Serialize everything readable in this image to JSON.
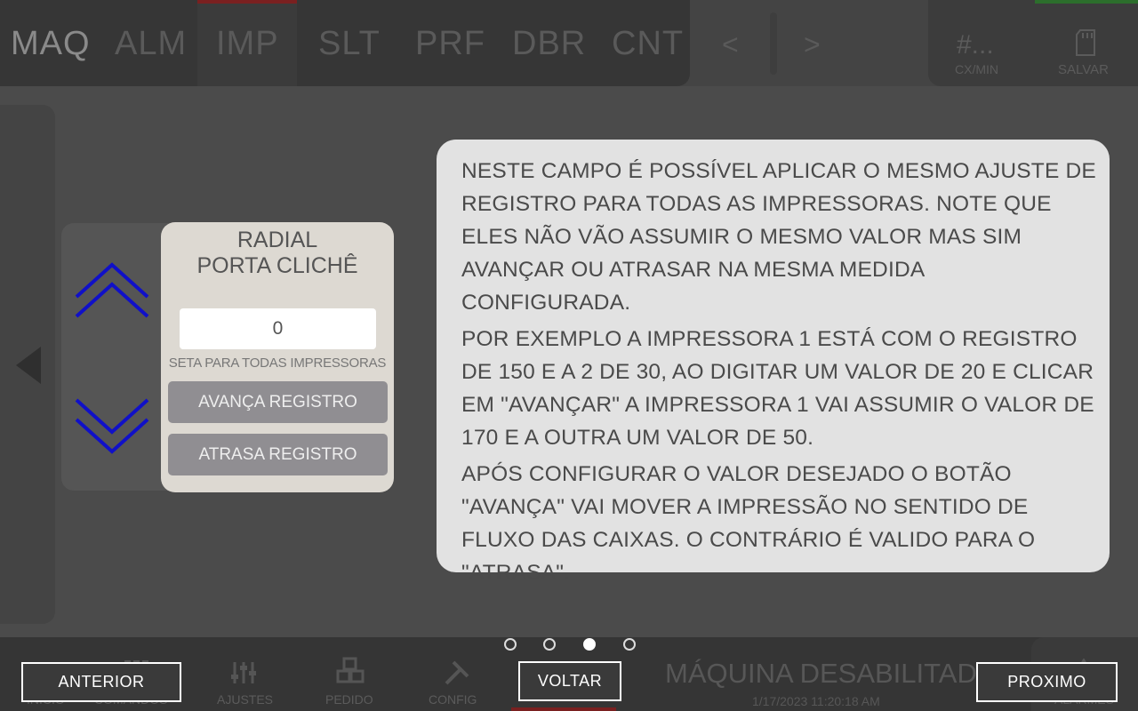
{
  "top_tabs": [
    "MAQ",
    "ALM",
    "IMP",
    "SLT",
    "PRF",
    "DBR",
    "CNT"
  ],
  "nav": {
    "prev_symbol": "<",
    "next_symbol": ">"
  },
  "rate": {
    "value": "#...",
    "unit": "CX/MIN"
  },
  "save_label": "SALVAR",
  "card": {
    "title_line1": "RADIAL",
    "title_line2": "PORTA CLICHÊ",
    "value": "0",
    "set_all_label": "SETA PARA TODAS IMPRESSORAS",
    "advance_label": "AVANÇA REGISTRO",
    "retard_label": "ATRASA REGISTRO"
  },
  "help": {
    "paragraphs": [
      "NESTE CAMPO É POSSÍVEL APLICAR O MESMO AJUSTE DE REGISTRO PARA TODAS AS IMPRESSORAS. NOTE QUE ELES NÃO VÃO ASSUMIR O MESMO VALOR MAS SIM AVANÇAR OU ATRASAR NA MESMA MEDIDA CONFIGURADA.",
      "POR EXEMPLO A IMPRESSORA 1 ESTÁ COM O REGISTRO DE 150 E A 2 DE 30, AO DIGITAR UM VALOR DE 20 E CLICAR EM \"AVANÇAR\" A IMPRESSORA 1 VAI ASSUMIR O VALOR DE 170 E A OUTRA UM VALOR DE 50.",
      "APÓS CONFIGURAR O VALOR DESEJADO O BOTÃO \"AVANÇA\" VAI MOVER A IMPRESSÃO NO SENTIDO DE FLUXO DAS CAIXAS. O CONTRÁRIO É VALIDO PARA O \"ATRASA\"."
    ]
  },
  "tour": {
    "page_count": 4,
    "current_page": 3,
    "prev_label": "ANTERIOR",
    "back_label": "VOLTAR",
    "next_label": "PROXIMO"
  },
  "bottom_nav": [
    "INICIO",
    "COMANDOS",
    "AJUSTES",
    "PEDIDO",
    "CONFIG"
  ],
  "status": {
    "title": "MÁQUINA DESABILITADA",
    "datetime": "1/17/2023 11:20:18 AM",
    "alarm_label": "ALARMES"
  },
  "colors": {
    "chevron": "#1010c8",
    "accent_red": "#7a2020",
    "accent_green": "#2c6e2c"
  }
}
